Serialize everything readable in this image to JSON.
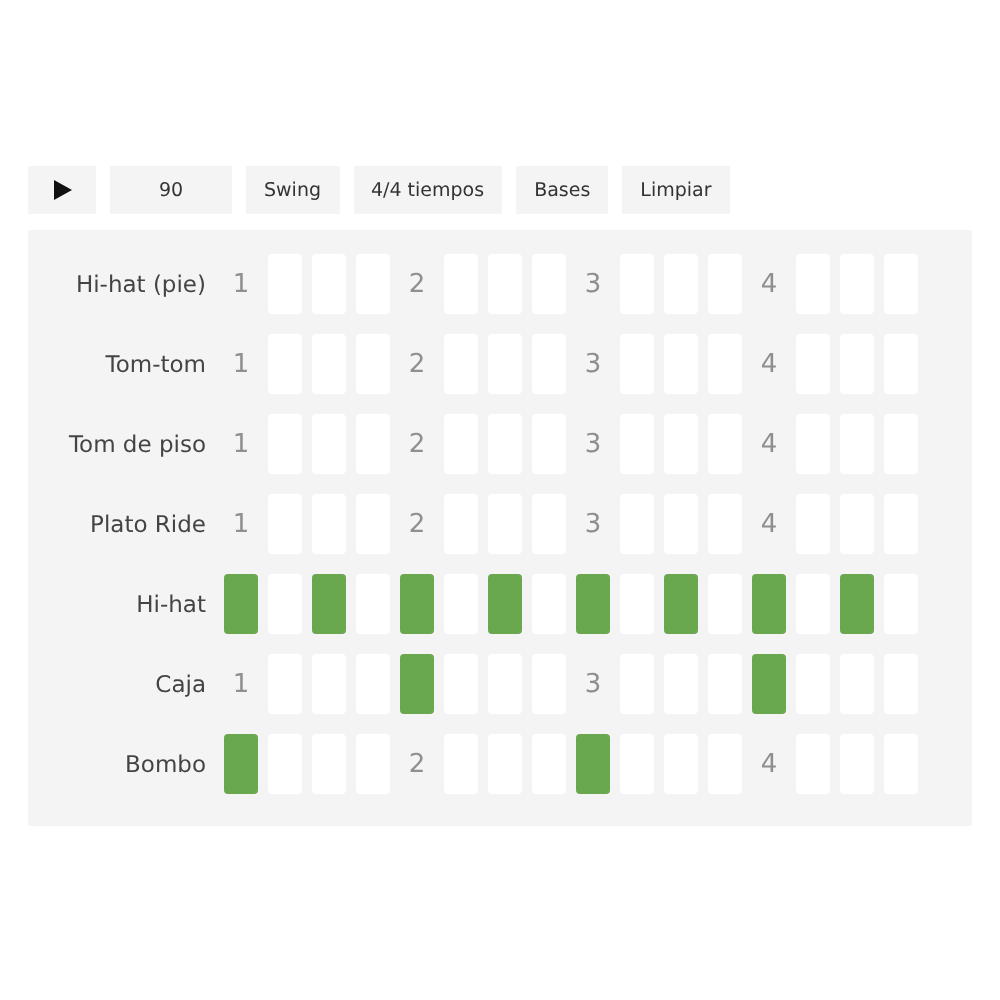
{
  "toolbar": {
    "tempo": "90",
    "buttons": [
      "Swing",
      "4/4 tiempos",
      "Bases",
      "Limpiar"
    ]
  },
  "rows": [
    {
      "name": "Hi-hat (pie)",
      "steps": [
        {
          "on": false,
          "label": "1"
        },
        {
          "on": false
        },
        {
          "on": false
        },
        {
          "on": false
        },
        {
          "on": false,
          "label": "2"
        },
        {
          "on": false
        },
        {
          "on": false
        },
        {
          "on": false
        },
        {
          "on": false,
          "label": "3"
        },
        {
          "on": false
        },
        {
          "on": false
        },
        {
          "on": false
        },
        {
          "on": false,
          "label": "4"
        },
        {
          "on": false
        },
        {
          "on": false
        },
        {
          "on": false
        }
      ]
    },
    {
      "name": "Tom-tom",
      "steps": [
        {
          "on": false,
          "label": "1"
        },
        {
          "on": false
        },
        {
          "on": false
        },
        {
          "on": false
        },
        {
          "on": false,
          "label": "2"
        },
        {
          "on": false
        },
        {
          "on": false
        },
        {
          "on": false
        },
        {
          "on": false,
          "label": "3"
        },
        {
          "on": false
        },
        {
          "on": false
        },
        {
          "on": false
        },
        {
          "on": false,
          "label": "4"
        },
        {
          "on": false
        },
        {
          "on": false
        },
        {
          "on": false
        }
      ]
    },
    {
      "name": "Tom de piso",
      "steps": [
        {
          "on": false,
          "label": "1"
        },
        {
          "on": false
        },
        {
          "on": false
        },
        {
          "on": false
        },
        {
          "on": false,
          "label": "2"
        },
        {
          "on": false
        },
        {
          "on": false
        },
        {
          "on": false
        },
        {
          "on": false,
          "label": "3"
        },
        {
          "on": false
        },
        {
          "on": false
        },
        {
          "on": false
        },
        {
          "on": false,
          "label": "4"
        },
        {
          "on": false
        },
        {
          "on": false
        },
        {
          "on": false
        }
      ]
    },
    {
      "name": "Plato Ride",
      "steps": [
        {
          "on": false,
          "label": "1"
        },
        {
          "on": false
        },
        {
          "on": false
        },
        {
          "on": false
        },
        {
          "on": false,
          "label": "2"
        },
        {
          "on": false
        },
        {
          "on": false
        },
        {
          "on": false
        },
        {
          "on": false,
          "label": "3"
        },
        {
          "on": false
        },
        {
          "on": false
        },
        {
          "on": false
        },
        {
          "on": false,
          "label": "4"
        },
        {
          "on": false
        },
        {
          "on": false
        },
        {
          "on": false
        }
      ]
    },
    {
      "name": "Hi-hat",
      "steps": [
        {
          "on": true
        },
        {
          "on": false
        },
        {
          "on": true
        },
        {
          "on": false
        },
        {
          "on": true
        },
        {
          "on": false
        },
        {
          "on": true
        },
        {
          "on": false
        },
        {
          "on": true
        },
        {
          "on": false
        },
        {
          "on": true
        },
        {
          "on": false
        },
        {
          "on": true
        },
        {
          "on": false
        },
        {
          "on": true
        },
        {
          "on": false
        }
      ]
    },
    {
      "name": "Caja",
      "steps": [
        {
          "on": false,
          "label": "1"
        },
        {
          "on": false
        },
        {
          "on": false
        },
        {
          "on": false
        },
        {
          "on": true
        },
        {
          "on": false
        },
        {
          "on": false
        },
        {
          "on": false
        },
        {
          "on": false,
          "label": "3"
        },
        {
          "on": false
        },
        {
          "on": false
        },
        {
          "on": false
        },
        {
          "on": true
        },
        {
          "on": false
        },
        {
          "on": false
        },
        {
          "on": false
        }
      ]
    },
    {
      "name": "Bombo",
      "steps": [
        {
          "on": true
        },
        {
          "on": false
        },
        {
          "on": false
        },
        {
          "on": false
        },
        {
          "on": false,
          "label": "2"
        },
        {
          "on": false
        },
        {
          "on": false
        },
        {
          "on": false
        },
        {
          "on": true
        },
        {
          "on": false
        },
        {
          "on": false
        },
        {
          "on": false
        },
        {
          "on": false,
          "label": "4"
        },
        {
          "on": false
        },
        {
          "on": false
        },
        {
          "on": false
        }
      ]
    }
  ]
}
